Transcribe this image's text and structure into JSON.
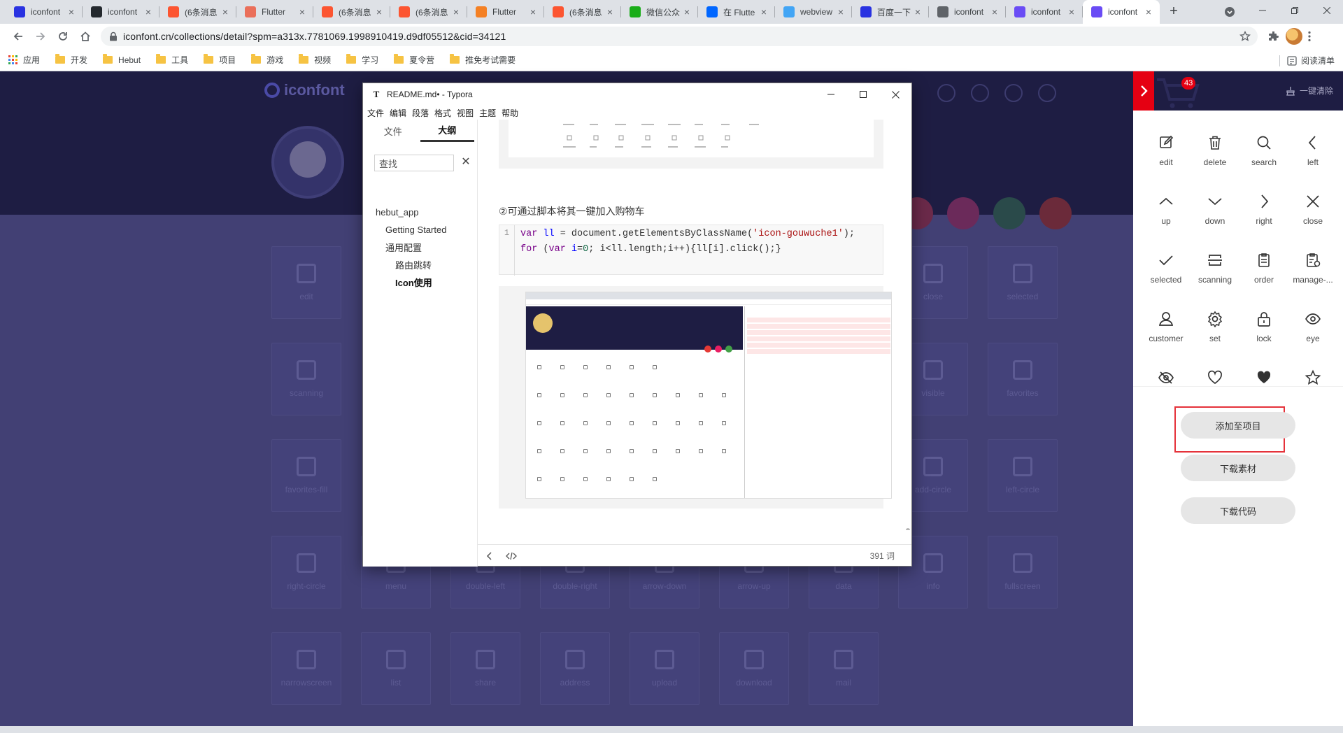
{
  "browser": {
    "tabs": [
      {
        "title": "iconfont",
        "favicon": "paw-icon",
        "color": "#2932e1"
      },
      {
        "title": "iconfont",
        "favicon": "github-icon",
        "color": "#24292e"
      },
      {
        "title": "(6条消息",
        "favicon": "csdn-icon",
        "color": "#fc5531"
      },
      {
        "title": "Flutter",
        "favicon": "jianshu-icon",
        "color": "#ea6f5a"
      },
      {
        "title": "(6条消息",
        "favicon": "csdn-icon",
        "color": "#fc5531"
      },
      {
        "title": "(6条消息",
        "favicon": "csdn-icon",
        "color": "#fc5531"
      },
      {
        "title": "Flutter",
        "favicon": "stackoverflow-icon",
        "color": "#f48024"
      },
      {
        "title": "(6条消息",
        "favicon": "csdn-icon",
        "color": "#fc5531"
      },
      {
        "title": "微信公众",
        "favicon": "wechat-icon",
        "color": "#1aad19"
      },
      {
        "title": "在 Flutte",
        "favicon": "zhihu-icon",
        "color": "#0066ff"
      },
      {
        "title": "webview",
        "favicon": "flutter-icon",
        "color": "#42a5f5"
      },
      {
        "title": "百度一下",
        "favicon": "paw-icon",
        "color": "#2932e1"
      },
      {
        "title": "iconfont",
        "favicon": "globe-icon",
        "color": "#5f6368"
      },
      {
        "title": "iconfont",
        "favicon": "iconfont-icon",
        "color": "#6a4cf5"
      },
      {
        "title": "iconfont",
        "favicon": "iconfont-icon",
        "color": "#6a4cf5",
        "active": true
      }
    ],
    "url": "iconfont.cn/collections/detail?spm=a313x.7781069.1998910419.d9df05512&cid=34121",
    "bookmarks": [
      "应用",
      "开发",
      "Hebut",
      "工具",
      "项目",
      "游戏",
      "视频",
      "学习",
      "夏令营",
      "推免考试需要"
    ],
    "reading_list": "阅读清单"
  },
  "page": {
    "logo": "iconfont",
    "cart_badge": "43",
    "background_cards": [
      "edit",
      "close",
      "selected",
      "scanning",
      "visible",
      "favorites",
      "favorites-fill",
      "add-circle",
      "left-circle",
      "right-circle",
      "menu",
      "double-left",
      "double-right",
      "arrow-down",
      "arrow-up",
      "data",
      "info",
      "fullscreen",
      "narrowscreen",
      "list",
      "share",
      "address",
      "upload",
      "download",
      "mail"
    ]
  },
  "cart": {
    "badge": "43",
    "clear_label": "一键清除",
    "icons": [
      {
        "label": "edit",
        "icon": "edit-icon"
      },
      {
        "label": "delete",
        "icon": "delete-icon"
      },
      {
        "label": "search",
        "icon": "search-icon"
      },
      {
        "label": "left",
        "icon": "chevron-left-icon"
      },
      {
        "label": "up",
        "icon": "chevron-up-icon"
      },
      {
        "label": "down",
        "icon": "chevron-down-icon"
      },
      {
        "label": "right",
        "icon": "chevron-right-icon"
      },
      {
        "label": "close",
        "icon": "close-icon"
      },
      {
        "label": "selected",
        "icon": "check-icon"
      },
      {
        "label": "scanning",
        "icon": "scanning-icon"
      },
      {
        "label": "order",
        "icon": "order-icon"
      },
      {
        "label": "manage-...",
        "icon": "manage-icon"
      },
      {
        "label": "customer",
        "icon": "user-icon"
      },
      {
        "label": "set",
        "icon": "gear-icon"
      },
      {
        "label": "lock",
        "icon": "lock-icon"
      },
      {
        "label": "eye",
        "icon": "eye-icon"
      },
      {
        "label": "",
        "icon": "eye-off-icon"
      },
      {
        "label": "",
        "icon": "heart-outline-icon"
      },
      {
        "label": "",
        "icon": "heart-fill-icon"
      },
      {
        "label": "",
        "icon": "star-icon"
      }
    ],
    "buttons": {
      "add_to_project": "添加至项目",
      "download_assets": "下载素材",
      "download_code": "下载代码"
    }
  },
  "typora": {
    "title": "README.md• - Typora",
    "menu": [
      "文件",
      "编辑",
      "段落",
      "格式",
      "视图",
      "主题",
      "帮助"
    ],
    "sidebar_tabs": [
      "文件",
      "大纲"
    ],
    "search_placeholder": "查找",
    "outline": [
      {
        "text": "hebut_app",
        "level": 1
      },
      {
        "text": "Getting Started",
        "level": 2
      },
      {
        "text": "通用配置",
        "level": 2
      },
      {
        "text": "路由跳转",
        "level": 3
      },
      {
        "text": "Icon使用",
        "level": 3,
        "current": true
      }
    ],
    "heading": "②可通过脚本将其一键加入购物车",
    "code_line_number": "1",
    "word_count": "391 词"
  }
}
